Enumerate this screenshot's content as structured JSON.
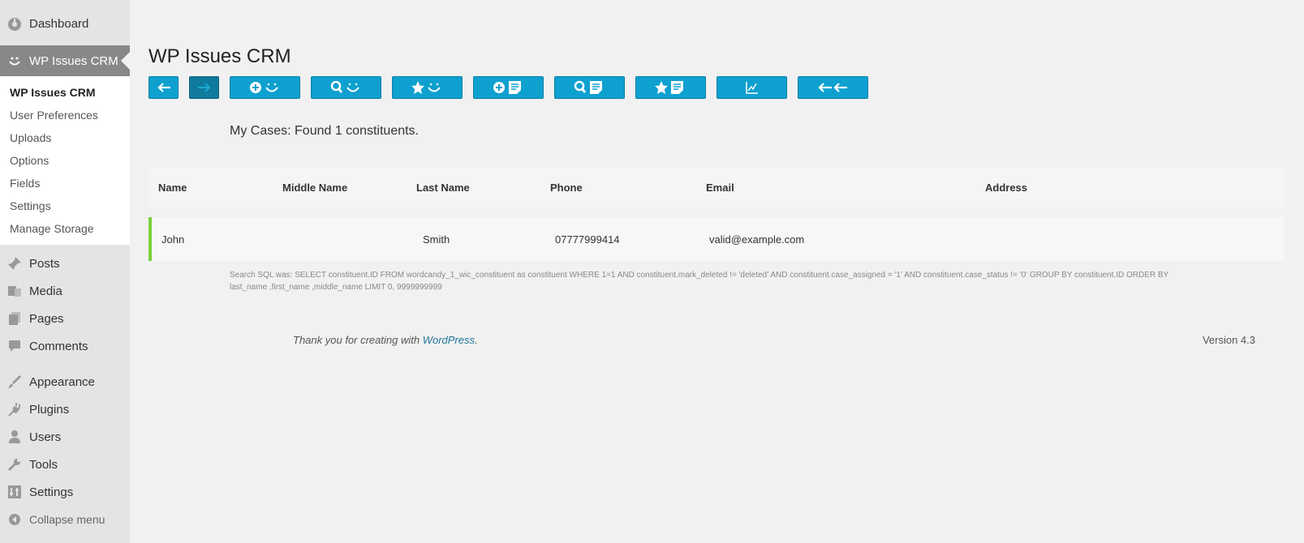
{
  "sidebar": {
    "top_items": [
      {
        "label": "Dashboard",
        "icon": "dashboard-icon"
      },
      {
        "label": "WP Issues CRM",
        "icon": "smile-icon"
      }
    ],
    "submenu": [
      "WP Issues CRM",
      "User Preferences",
      "Uploads",
      "Options",
      "Fields",
      "Settings",
      "Manage Storage"
    ],
    "items": [
      {
        "label": "Posts",
        "icon": "pin-icon"
      },
      {
        "label": "Media",
        "icon": "media-icon"
      },
      {
        "label": "Pages",
        "icon": "pages-icon"
      },
      {
        "label": "Comments",
        "icon": "comment-icon"
      },
      {
        "label": "Appearance",
        "icon": "brush-icon"
      },
      {
        "label": "Plugins",
        "icon": "plug-icon"
      },
      {
        "label": "Users",
        "icon": "user-icon"
      },
      {
        "label": "Tools",
        "icon": "wrench-icon"
      },
      {
        "label": "Settings",
        "icon": "settings-icon"
      }
    ],
    "collapse_label": "Collapse menu"
  },
  "page_title": "WP Issues CRM",
  "toolbar": [
    {
      "icon": "arrow-left-icon"
    },
    {
      "icon": "arrow-right-icon"
    },
    {
      "icon": "new-constituent-icon"
    },
    {
      "icon": "search-constituent-icon"
    },
    {
      "icon": "favorite-constituent-icon"
    },
    {
      "icon": "new-issue-icon"
    },
    {
      "icon": "search-issue-icon"
    },
    {
      "icon": "favorite-issue-icon"
    },
    {
      "icon": "chart-icon"
    },
    {
      "icon": "double-arrow-left-icon"
    }
  ],
  "found_text": "My Cases: Found 1 constituents.",
  "table": {
    "headers": [
      "Name",
      "Middle Name",
      "Last Name",
      "Phone",
      "Email",
      "Address"
    ],
    "rows": [
      [
        "John",
        "",
        "Smith",
        "07777999414",
        "valid@example.com",
        ""
      ]
    ]
  },
  "sql_text": "Search SQL was: SELECT constituent.ID FROM wordcandy_1_wic_constituent as constituent WHERE 1=1 AND constituent.mark_deleted != 'deleted' AND constituent.case_assigned = '1' AND constituent.case_status != '0' GROUP BY constituent.ID ORDER BY last_name ,first_name ,middle_name LIMIT 0, 9999999999",
  "footer": {
    "thanks_prefix": "Thank you for creating with ",
    "thanks_link": "WordPress",
    "thanks_suffix": ".",
    "version": "Version 4.3"
  },
  "colors": {
    "accent": "#0ea0cf",
    "row_marker": "#7ad03a",
    "link": "#21759b"
  }
}
